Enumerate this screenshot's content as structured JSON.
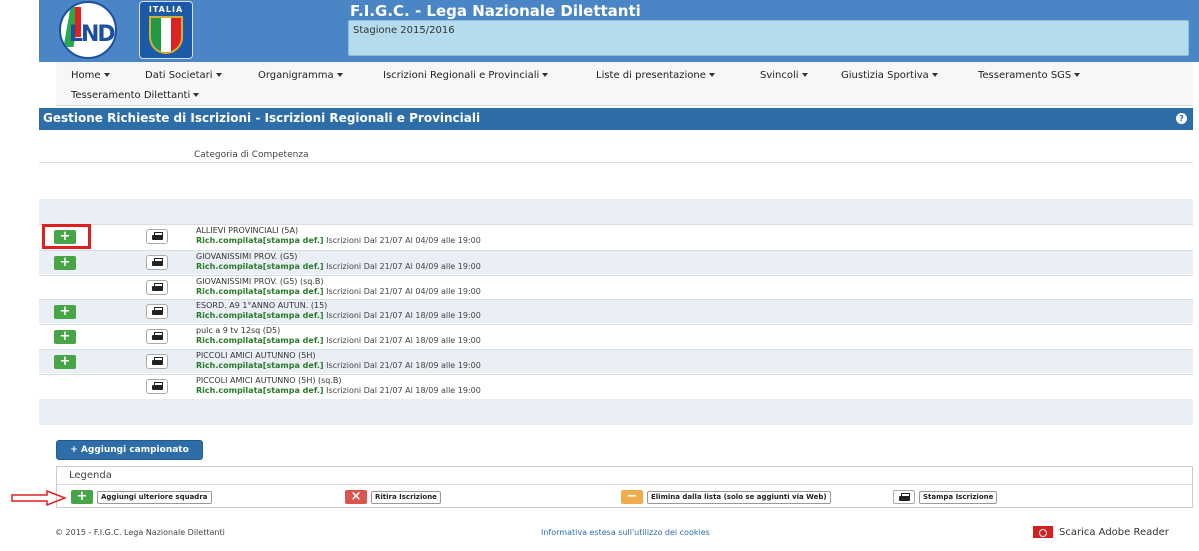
{
  "header": {
    "logo_left_text": "LND",
    "logo_right_text": "ITALIA",
    "title": "F.I.G.C. - Lega Nazionale Dilettanti",
    "season": "Stagione 2015/2016"
  },
  "nav": {
    "items": [
      {
        "label": "Home"
      },
      {
        "label": "Dati Societari"
      },
      {
        "label": "Organigramma"
      },
      {
        "label": "Iscrizioni Regionali e Provinciali"
      },
      {
        "label": "Liste di presentazione"
      },
      {
        "label": "Svincoli"
      },
      {
        "label": "Giustizia Sportiva"
      },
      {
        "label": "Tesseramento SGS"
      },
      {
        "label": "Tesseramento Dilettanti"
      }
    ]
  },
  "page": {
    "title": "Gestione Richieste di Iscrizioni - Iscrizioni Regionali e Provinciali",
    "help_icon": "question-icon",
    "column_header": "Categoria di Competenza"
  },
  "rows": [
    {
      "name": "ALLIEVI PROVINCIALI (5A)",
      "status": "Rich.compilata[stampa def.]",
      "period": "Iscrizioni Dal 21/07 Al 04/09 alle 19:00",
      "can_add": true
    },
    {
      "name": "GIOVANISSIMI PROV. (G5)",
      "status": "Rich.compilata[stampa def.]",
      "period": "Iscrizioni Dal 21/07 Al 04/09 alle 19:00",
      "can_add": true
    },
    {
      "name": "GIOVANISSIMI PROV. (G5)  (sq.B)",
      "status": "Rich.compilata[stampa def.]",
      "period": "Iscrizioni Dal 21/07 Al 04/09 alle 19:00",
      "can_add": false
    },
    {
      "name": "ESORD. A9 1°ANNO AUTUN. (15)",
      "status": "Rich.compilata[stampa def.]",
      "period": "Iscrizioni Dal 21/07 Al 18/09 alle 19:00",
      "can_add": true
    },
    {
      "name": "pulc a 9 tv 12sq (D5)",
      "status": "Rich.compilata[stampa def.]",
      "period": "Iscrizioni Dal 21/07 Al 18/09 alle 19:00",
      "can_add": true
    },
    {
      "name": "PICCOLI AMICI AUTUNNO (5H)",
      "status": "Rich.compilata[stampa def.]",
      "period": "Iscrizioni Dal 21/07 Al 18/09 alle 19:00",
      "can_add": true
    },
    {
      "name": "PICCOLI AMICI AUTUNNO (5H)  (sq.B)",
      "status": "Rich.compilata[stampa def.]",
      "period": "Iscrizioni Dal 21/07 Al 18/09 alle 19:00",
      "can_add": false
    }
  ],
  "actions": {
    "add_championship": "Aggiungi campionato"
  },
  "legend": {
    "title": "Legenda",
    "add_team": "Aggiungi ulteriore squadra",
    "withdraw": "Ritira Iscrizione",
    "remove": "Elimina dalla lista (solo se aggiunti via Web)",
    "print": "Stampa Iscrizione"
  },
  "footer": {
    "copyright": "© 2015 - F.I.G.C. Lega Nazionale Dilettanti",
    "cookies": "Informativa estesa sull'utilizzo dei cookies",
    "adobe": "Scarica Adobe Reader"
  },
  "colors": {
    "header_blue": "#4a86c5",
    "title_blue": "#2d6da8",
    "add_green": "#47a447",
    "withdraw_red": "#d9534f",
    "remove_orange": "#f0ad4e",
    "highlight_red": "#e02020"
  }
}
